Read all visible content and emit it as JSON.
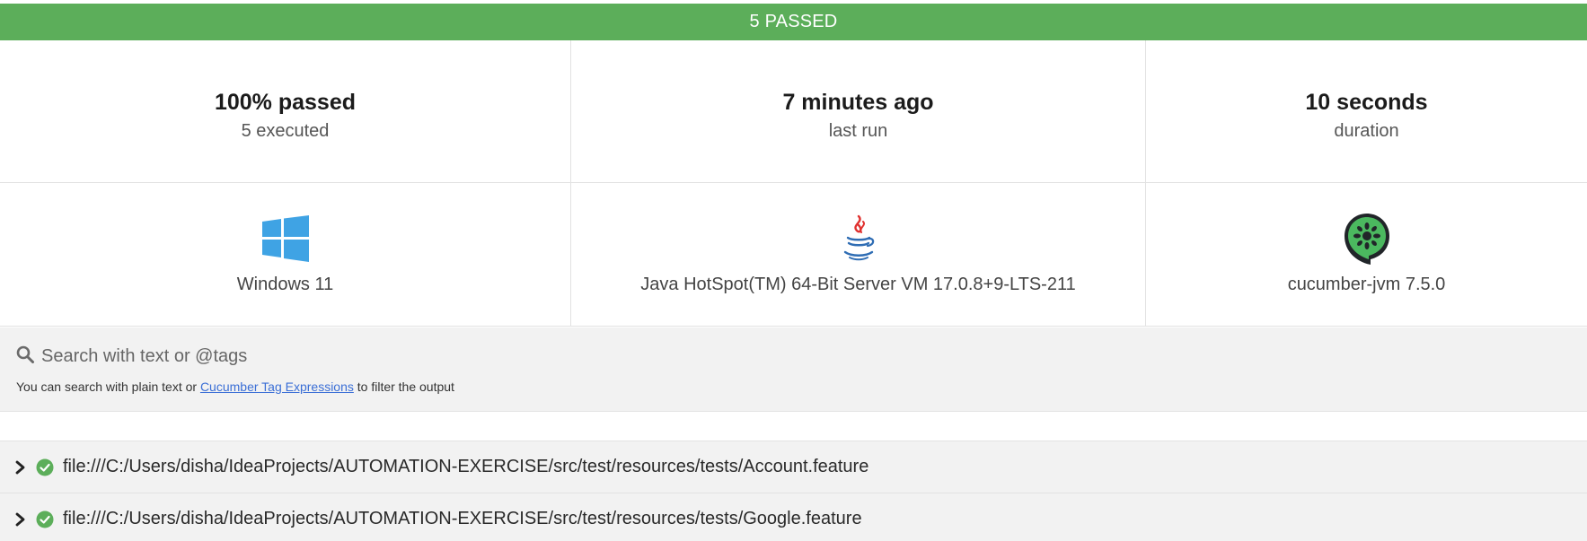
{
  "banner": {
    "text": "5 PASSED",
    "color": "#5cae5a"
  },
  "stats": [
    {
      "value": "100% passed",
      "label": "5 executed"
    },
    {
      "value": "7 minutes ago",
      "label": "last run"
    },
    {
      "value": "10 seconds",
      "label": "duration"
    }
  ],
  "environment": [
    {
      "icon": "windows-icon",
      "label": "Windows 11"
    },
    {
      "icon": "java-icon",
      "label": "Java HotSpot(TM) 64-Bit Server VM 17.0.8+9-LTS-211"
    },
    {
      "icon": "cucumber-icon",
      "label": "cucumber-jvm 7.5.0"
    }
  ],
  "search": {
    "placeholder": "Search with text or @tags",
    "value": "",
    "hint_before": "You can search with plain text or",
    "hint_link": "Cucumber Tag Expressions",
    "hint_after": "to filter the output"
  },
  "features": [
    {
      "status": "passed",
      "path": "file:///C:/Users/disha/IdeaProjects/AUTOMATION-EXERCISE/src/test/resources/tests/Account.feature"
    },
    {
      "status": "passed",
      "path": "file:///C:/Users/disha/IdeaProjects/AUTOMATION-EXERCISE/src/test/resources/tests/Google.feature"
    }
  ],
  "colors": {
    "passed": "#5cae5a",
    "link": "#3b6fd6",
    "panel": "#f2f2f2"
  }
}
